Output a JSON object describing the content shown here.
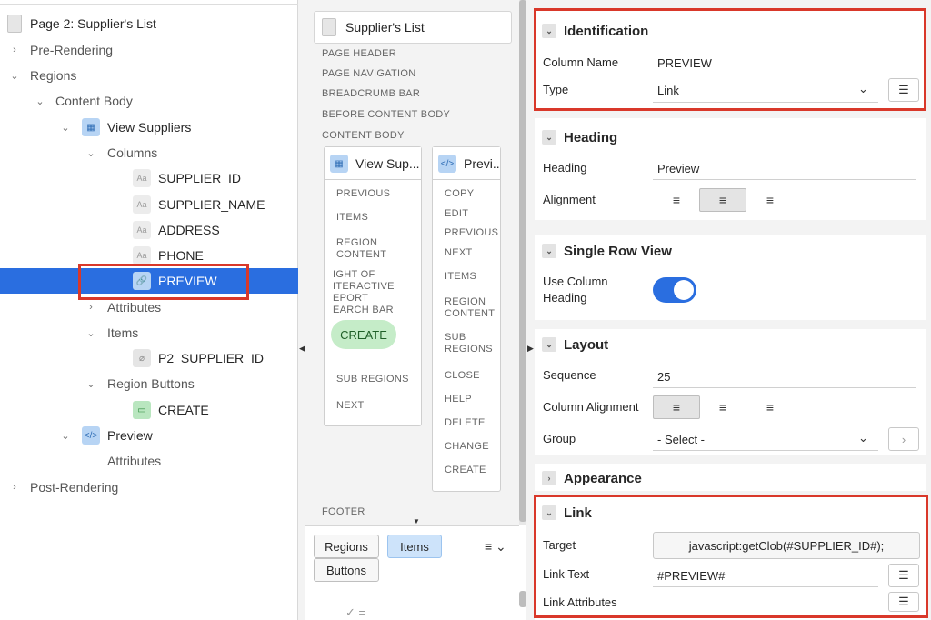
{
  "tree": {
    "page": "Page 2: Supplier's List",
    "pre_rendering": "Pre-Rendering",
    "regions": "Regions",
    "content_body": "Content Body",
    "view_suppliers": "View Suppliers",
    "columns": "Columns",
    "cols": [
      "SUPPLIER_ID",
      "SUPPLIER_NAME",
      "ADDRESS",
      "PHONE",
      "PREVIEW"
    ],
    "attributes": "Attributes",
    "items": "Items",
    "item_p2": "P2_SUPPLIER_ID",
    "region_buttons": "Region Buttons",
    "create": "CREATE",
    "preview": "Preview",
    "preview_attributes": "Attributes",
    "post_rendering": "Post-Rendering",
    "col_icon_text": "Aa"
  },
  "layout": {
    "page_title": "Supplier's List",
    "slots": [
      "PAGE HEADER",
      "PAGE NAVIGATION",
      "BREADCRUMB BAR",
      "BEFORE CONTENT BODY",
      "CONTENT BODY"
    ],
    "region1": {
      "title": "View Sup...",
      "subs": [
        "PREVIOUS",
        "ITEMS",
        "REGION",
        "CONTENT",
        "IGHT OF",
        "ITERACTIVE",
        "EPORT",
        "EARCH BAR",
        "SUB REGIONS",
        "NEXT"
      ],
      "create_button": "CREATE"
    },
    "region2": {
      "title": "Previ...",
      "subs": [
        "COPY",
        "EDIT",
        "PREVIOUS",
        "NEXT",
        "ITEMS",
        "REGION",
        "CONTENT",
        "SUB",
        "REGIONS",
        "CLOSE",
        "HELP",
        "DELETE",
        "CHANGE",
        "CREATE"
      ]
    },
    "footer": "FOOTER",
    "tabs": {
      "regions": "Regions",
      "items": "Items",
      "buttons": "Buttons"
    }
  },
  "properties": {
    "identification": {
      "title": "Identification",
      "column_name_label": "Column Name",
      "column_name_value": "PREVIEW",
      "type_label": "Type",
      "type_value": "Link"
    },
    "heading": {
      "title": "Heading",
      "heading_label": "Heading",
      "heading_value": "Preview",
      "alignment_label": "Alignment"
    },
    "single_row_view": {
      "title": "Single Row View",
      "use_column_label_1": "Use Column",
      "use_column_label_2": "Heading",
      "use_column_heading": true
    },
    "layout": {
      "title": "Layout",
      "sequence_label": "Sequence",
      "sequence_value": "25",
      "column_alignment_label": "Column Alignment",
      "group_label": "Group",
      "group_value": "- Select -"
    },
    "appearance": {
      "title": "Appearance"
    },
    "link": {
      "title": "Link",
      "target_label": "Target",
      "target_value": "javascript:getClob(#SUPPLIER_ID#);",
      "link_text_label": "Link Text",
      "link_text_value": "#PREVIEW#",
      "link_attributes_label": "Link Attributes"
    }
  },
  "colors": {
    "selection": "#2a6ee0",
    "highlight_frame": "#d9382a",
    "create_pill": "#c5ecc8"
  }
}
